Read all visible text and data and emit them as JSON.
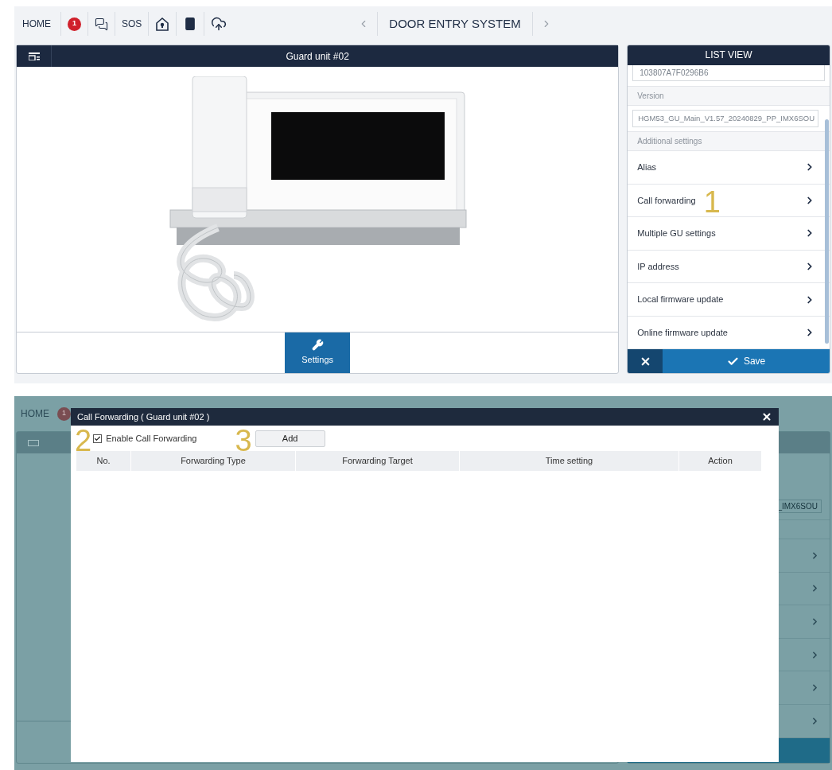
{
  "screen_1": {
    "toolbar": {
      "home": "HOME",
      "notification_count": "1",
      "sos": "SOS",
      "title": "DOOR ENTRY SYSTEM"
    },
    "device_panel": {
      "title": "Guard unit #02",
      "settings_button": "Settings"
    },
    "list_view": {
      "title": "LIST VIEW",
      "id_value": "103807A7F0296B6",
      "version_label": "Version",
      "version_value": "HGM53_GU_Main_V1.57_20240829_PP_IMX6SOU",
      "section_label": "Additional settings",
      "items": [
        {
          "label": "Alias"
        },
        {
          "label": "Call forwarding",
          "callout": "1"
        },
        {
          "label": "Multiple GU settings"
        },
        {
          "label": "IP address"
        },
        {
          "label": "Local firmware update"
        },
        {
          "label": "Online firmware update"
        }
      ],
      "save_button": "Save"
    }
  },
  "screen_2": {
    "toolbar": {
      "home": "HOME",
      "notification_count": "1"
    },
    "version_value": "_IMX6SOU",
    "dialog": {
      "title": "Call Forwarding ( Guard unit #02 )",
      "enable_checkbox": {
        "label": "Enable Call Forwarding",
        "checked": true,
        "callout": "2"
      },
      "add_button": {
        "label": "Add",
        "callout": "3"
      },
      "table": {
        "columns": [
          "No.",
          "Forwarding Type",
          "Forwarding Target",
          "Time setting",
          "Action"
        ]
      }
    }
  }
}
